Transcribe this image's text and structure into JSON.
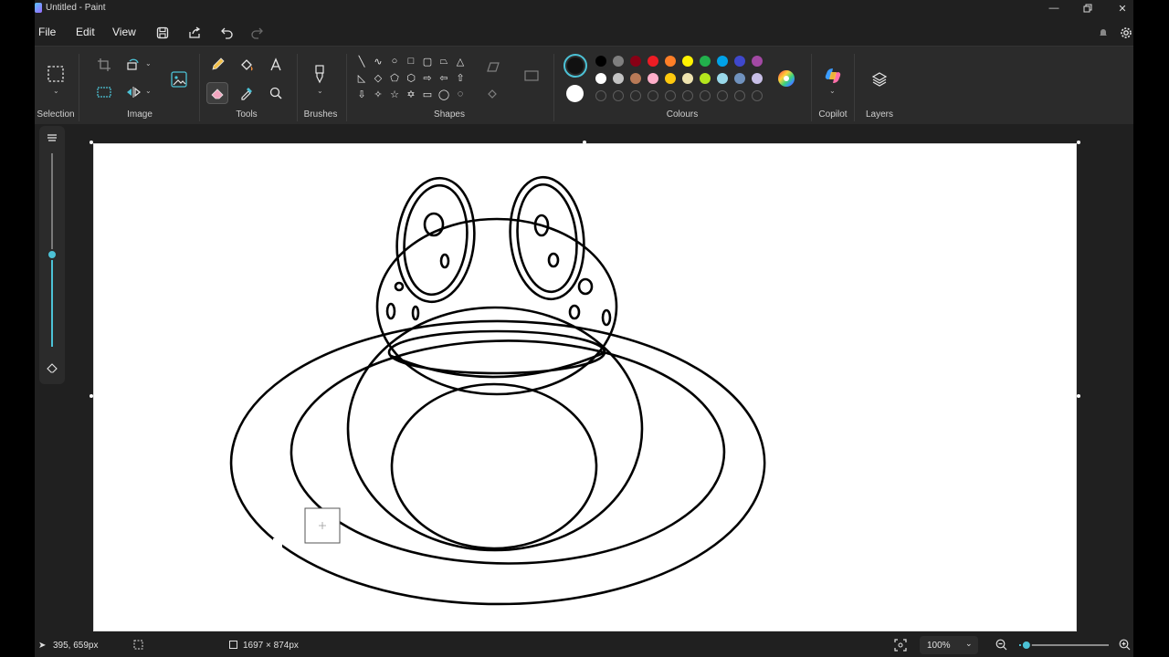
{
  "window": {
    "title": "Untitled - Paint"
  },
  "menu": {
    "file": "File",
    "edit": "Edit",
    "view": "View"
  },
  "ribbon": {
    "groups": {
      "selection": "Selection",
      "image": "Image",
      "tools": "Tools",
      "brushes": "Brushes",
      "shapes": "Shapes",
      "colours": "Colours",
      "copilot": "Copilot",
      "layers": "Layers"
    },
    "colours": {
      "primary": "#111111",
      "secondary": "#ffffff",
      "row1": [
        "#000000",
        "#7f7f7f",
        "#880015",
        "#ed1c24",
        "#ff7f27",
        "#fff200",
        "#22b14c",
        "#00a2e8",
        "#3f48cc",
        "#a349a4"
      ],
      "row2": [
        "#ffffff",
        "#c3c3c3",
        "#b97a57",
        "#ffaec9",
        "#ffc90e",
        "#efe4b0",
        "#b5e61d",
        "#99d9ea",
        "#7092be",
        "#c8bfe7"
      ]
    }
  },
  "status": {
    "cursor": "395, 659px",
    "canvas_size": "1697 × 874px",
    "zoom": "100%",
    "zoom_slider": 0.08
  },
  "accent": "#4cc2d6"
}
